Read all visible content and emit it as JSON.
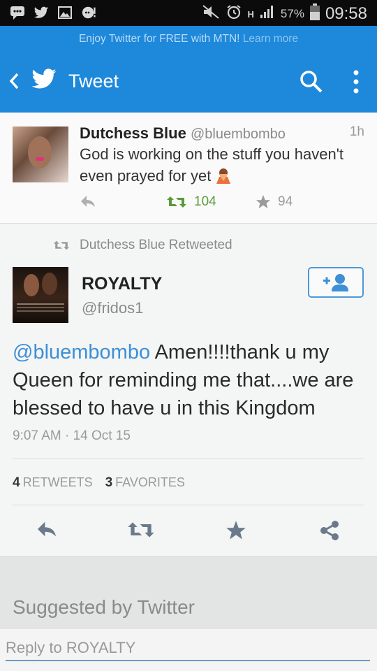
{
  "status_bar": {
    "battery_percent": "57%",
    "time": "09:58",
    "network": "H"
  },
  "promo": {
    "text": "Enjoy Twitter for FREE with MTN!",
    "link": "Learn more"
  },
  "header": {
    "title": "Tweet"
  },
  "top_tweet": {
    "name": "Dutchess Blue",
    "handle": "@bluembombo",
    "age": "1h",
    "text": "God is working  on the  stuff you haven't  even prayed for  yet",
    "retweets": "104",
    "favorites": "94"
  },
  "retweet_context": {
    "text": "Dutchess Blue Retweeted"
  },
  "main_tweet": {
    "name": "ROYALTY",
    "handle": "@fridos1",
    "mention": "@bluembombo",
    "text": " Amen!!!!thank u my Queen for reminding me that....we are blessed to have u in this Kingdom",
    "datetime": "9:07 AM · 14 Oct 15",
    "retweets_count": "4",
    "retweets_label": "RETWEETS",
    "favorites_count": "3",
    "favorites_label": "FAVORITES"
  },
  "suggested": {
    "title": "Suggested by Twitter"
  },
  "reply": {
    "placeholder": "Reply to ROYALTY"
  },
  "colors": {
    "twitter_blue": "#1e88db",
    "retweet_green": "#5a9a3c",
    "mention_blue": "#3d8fd6"
  }
}
